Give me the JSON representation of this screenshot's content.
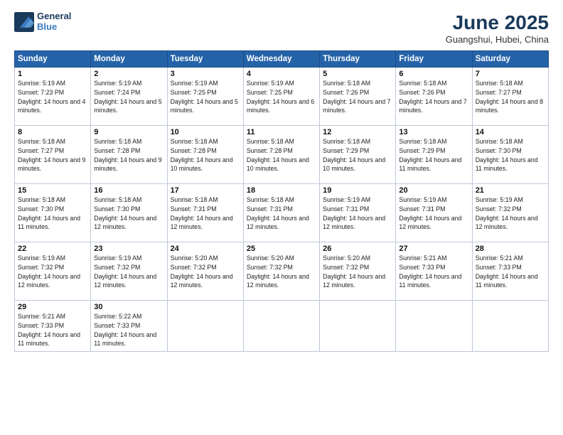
{
  "logo": {
    "line1": "General",
    "line2": "Blue"
  },
  "title": "June 2025",
  "location": "Guangshui, Hubei, China",
  "weekdays": [
    "Sunday",
    "Monday",
    "Tuesday",
    "Wednesday",
    "Thursday",
    "Friday",
    "Saturday"
  ],
  "weeks": [
    [
      {
        "day": "1",
        "sunrise": "5:19 AM",
        "sunset": "7:23 PM",
        "daylight": "14 hours and 4 minutes."
      },
      {
        "day": "2",
        "sunrise": "5:19 AM",
        "sunset": "7:24 PM",
        "daylight": "14 hours and 5 minutes."
      },
      {
        "day": "3",
        "sunrise": "5:19 AM",
        "sunset": "7:25 PM",
        "daylight": "14 hours and 5 minutes."
      },
      {
        "day": "4",
        "sunrise": "5:19 AM",
        "sunset": "7:25 PM",
        "daylight": "14 hours and 6 minutes."
      },
      {
        "day": "5",
        "sunrise": "5:18 AM",
        "sunset": "7:26 PM",
        "daylight": "14 hours and 7 minutes."
      },
      {
        "day": "6",
        "sunrise": "5:18 AM",
        "sunset": "7:26 PM",
        "daylight": "14 hours and 7 minutes."
      },
      {
        "day": "7",
        "sunrise": "5:18 AM",
        "sunset": "7:27 PM",
        "daylight": "14 hours and 8 minutes."
      }
    ],
    [
      {
        "day": "8",
        "sunrise": "5:18 AM",
        "sunset": "7:27 PM",
        "daylight": "14 hours and 9 minutes."
      },
      {
        "day": "9",
        "sunrise": "5:18 AM",
        "sunset": "7:28 PM",
        "daylight": "14 hours and 9 minutes."
      },
      {
        "day": "10",
        "sunrise": "5:18 AM",
        "sunset": "7:28 PM",
        "daylight": "14 hours and 10 minutes."
      },
      {
        "day": "11",
        "sunrise": "5:18 AM",
        "sunset": "7:28 PM",
        "daylight": "14 hours and 10 minutes."
      },
      {
        "day": "12",
        "sunrise": "5:18 AM",
        "sunset": "7:29 PM",
        "daylight": "14 hours and 10 minutes."
      },
      {
        "day": "13",
        "sunrise": "5:18 AM",
        "sunset": "7:29 PM",
        "daylight": "14 hours and 11 minutes."
      },
      {
        "day": "14",
        "sunrise": "5:18 AM",
        "sunset": "7:30 PM",
        "daylight": "14 hours and 11 minutes."
      }
    ],
    [
      {
        "day": "15",
        "sunrise": "5:18 AM",
        "sunset": "7:30 PM",
        "daylight": "14 hours and 11 minutes."
      },
      {
        "day": "16",
        "sunrise": "5:18 AM",
        "sunset": "7:30 PM",
        "daylight": "14 hours and 12 minutes."
      },
      {
        "day": "17",
        "sunrise": "5:18 AM",
        "sunset": "7:31 PM",
        "daylight": "14 hours and 12 minutes."
      },
      {
        "day": "18",
        "sunrise": "5:18 AM",
        "sunset": "7:31 PM",
        "daylight": "14 hours and 12 minutes."
      },
      {
        "day": "19",
        "sunrise": "5:19 AM",
        "sunset": "7:31 PM",
        "daylight": "14 hours and 12 minutes."
      },
      {
        "day": "20",
        "sunrise": "5:19 AM",
        "sunset": "7:31 PM",
        "daylight": "14 hours and 12 minutes."
      },
      {
        "day": "21",
        "sunrise": "5:19 AM",
        "sunset": "7:32 PM",
        "daylight": "14 hours and 12 minutes."
      }
    ],
    [
      {
        "day": "22",
        "sunrise": "5:19 AM",
        "sunset": "7:32 PM",
        "daylight": "14 hours and 12 minutes."
      },
      {
        "day": "23",
        "sunrise": "5:19 AM",
        "sunset": "7:32 PM",
        "daylight": "14 hours and 12 minutes."
      },
      {
        "day": "24",
        "sunrise": "5:20 AM",
        "sunset": "7:32 PM",
        "daylight": "14 hours and 12 minutes."
      },
      {
        "day": "25",
        "sunrise": "5:20 AM",
        "sunset": "7:32 PM",
        "daylight": "14 hours and 12 minutes."
      },
      {
        "day": "26",
        "sunrise": "5:20 AM",
        "sunset": "7:32 PM",
        "daylight": "14 hours and 12 minutes."
      },
      {
        "day": "27",
        "sunrise": "5:21 AM",
        "sunset": "7:33 PM",
        "daylight": "14 hours and 11 minutes."
      },
      {
        "day": "28",
        "sunrise": "5:21 AM",
        "sunset": "7:33 PM",
        "daylight": "14 hours and 11 minutes."
      }
    ],
    [
      {
        "day": "29",
        "sunrise": "5:21 AM",
        "sunset": "7:33 PM",
        "daylight": "14 hours and 11 minutes."
      },
      {
        "day": "30",
        "sunrise": "5:22 AM",
        "sunset": "7:33 PM",
        "daylight": "14 hours and 11 minutes."
      },
      null,
      null,
      null,
      null,
      null
    ]
  ]
}
